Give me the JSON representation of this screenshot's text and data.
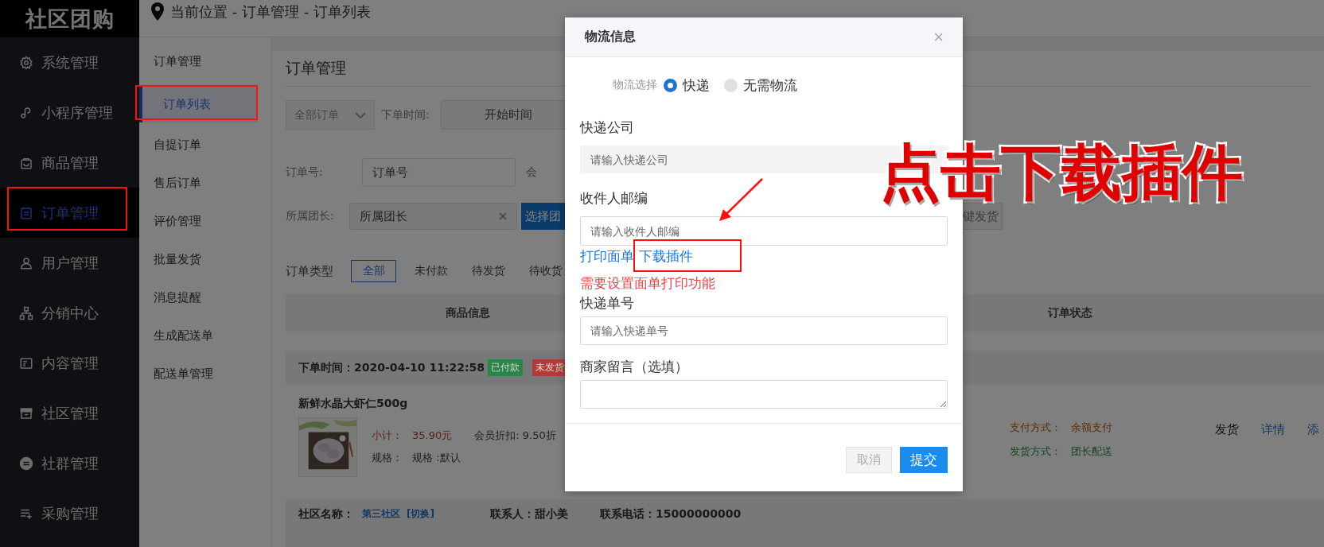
{
  "logo": "社区团购",
  "sidebar": {
    "items": [
      {
        "label": "系统管理",
        "selected": false
      },
      {
        "label": "小程序管理",
        "selected": false
      },
      {
        "label": "商品管理",
        "selected": false
      },
      {
        "label": "订单管理",
        "selected": true
      },
      {
        "label": "用户管理",
        "selected": false
      },
      {
        "label": "分销中心",
        "selected": false
      },
      {
        "label": "内容管理",
        "selected": false
      },
      {
        "label": "社区管理",
        "selected": false
      },
      {
        "label": "社群管理",
        "selected": false
      },
      {
        "label": "采购管理",
        "selected": false
      }
    ]
  },
  "breadcrumb": "当前位置 - 订单管理 - 订单列表",
  "submenu": {
    "title": "订单管理",
    "items": [
      {
        "label": "订单列表",
        "selected": true
      },
      {
        "label": "自提订单",
        "selected": false
      },
      {
        "label": "售后订单",
        "selected": false
      },
      {
        "label": "评价管理",
        "selected": false
      },
      {
        "label": "批量发货",
        "selected": false
      },
      {
        "label": "消息提醒",
        "selected": false
      },
      {
        "label": "生成配送单",
        "selected": false
      },
      {
        "label": "配送单管理",
        "selected": false
      }
    ]
  },
  "main": {
    "title": "订单管理",
    "filters": {
      "status_select": "全部订单",
      "time_label": "下单时间:",
      "start_time": "开始时间",
      "order_no_label": "订单号:",
      "order_no_placeholder": "订单号",
      "member_label": "会",
      "leader_label": "所属团长:",
      "leader_placeholder": "所属团长",
      "choose_button": "选择团",
      "ship_button": "键发货"
    },
    "order_types": {
      "label": "订单类型",
      "tabs": [
        {
          "label": "全部",
          "selected": true
        },
        {
          "label": "未付款",
          "selected": false
        },
        {
          "label": "待发货",
          "selected": false
        },
        {
          "label": "待收货",
          "selected": false
        }
      ]
    },
    "table": {
      "columns": [
        "商品信息",
        "订单状态"
      ]
    },
    "order": {
      "time": "下单时间：2020-04-10 11:22:58",
      "badges": [
        {
          "label": "已付款",
          "color": "#2a8646"
        },
        {
          "label": "未发货",
          "color": "#b33a3a"
        }
      ],
      "product": {
        "name": "新鲜水晶大虾仁500g",
        "subtotal_label": "小计：",
        "subtotal": "35.90元",
        "discount": "会员折扣: 9.50折",
        "spec_label": "规格：",
        "spec": "规格 :默认"
      },
      "payment_label": "支付方式：",
      "payment": "余额支付",
      "delivery_label": "发货方式：",
      "delivery": "团长配送",
      "actions": [
        {
          "label": "发货",
          "kind": "primary"
        },
        {
          "label": "详情",
          "kind": "link"
        },
        {
          "label": "添",
          "kind": "link"
        }
      ]
    },
    "next_order": {
      "community_label": "社区名称：",
      "community": "第三社区",
      "switch": "[切换]",
      "contact": "联系人：甜小美",
      "phone": "联系电话：15000000000"
    }
  },
  "modal": {
    "title": "物流信息",
    "close": "×",
    "logistics_label": "物流选择",
    "options": [
      {
        "label": "快递",
        "selected": true
      },
      {
        "label": "无需物流",
        "selected": false
      }
    ],
    "company_label": "快递公司",
    "company_placeholder": "请输入快递公司",
    "zip_label": "收件人邮编",
    "zip_placeholder": "请输入收件人邮编",
    "links": [
      "打印面单",
      "下载插件"
    ],
    "warning": "需要设置面单打印功能",
    "tracking_label": "快递单号",
    "tracking_placeholder": "请输入快递单号",
    "note_label": "商家留言（选填）",
    "buttons": [
      {
        "label": "取消",
        "kind": "cancel",
        "disabled": true
      },
      {
        "label": "提交",
        "kind": "submit",
        "disabled": false
      }
    ]
  },
  "annotation": {
    "callout": "点击下载插件"
  }
}
